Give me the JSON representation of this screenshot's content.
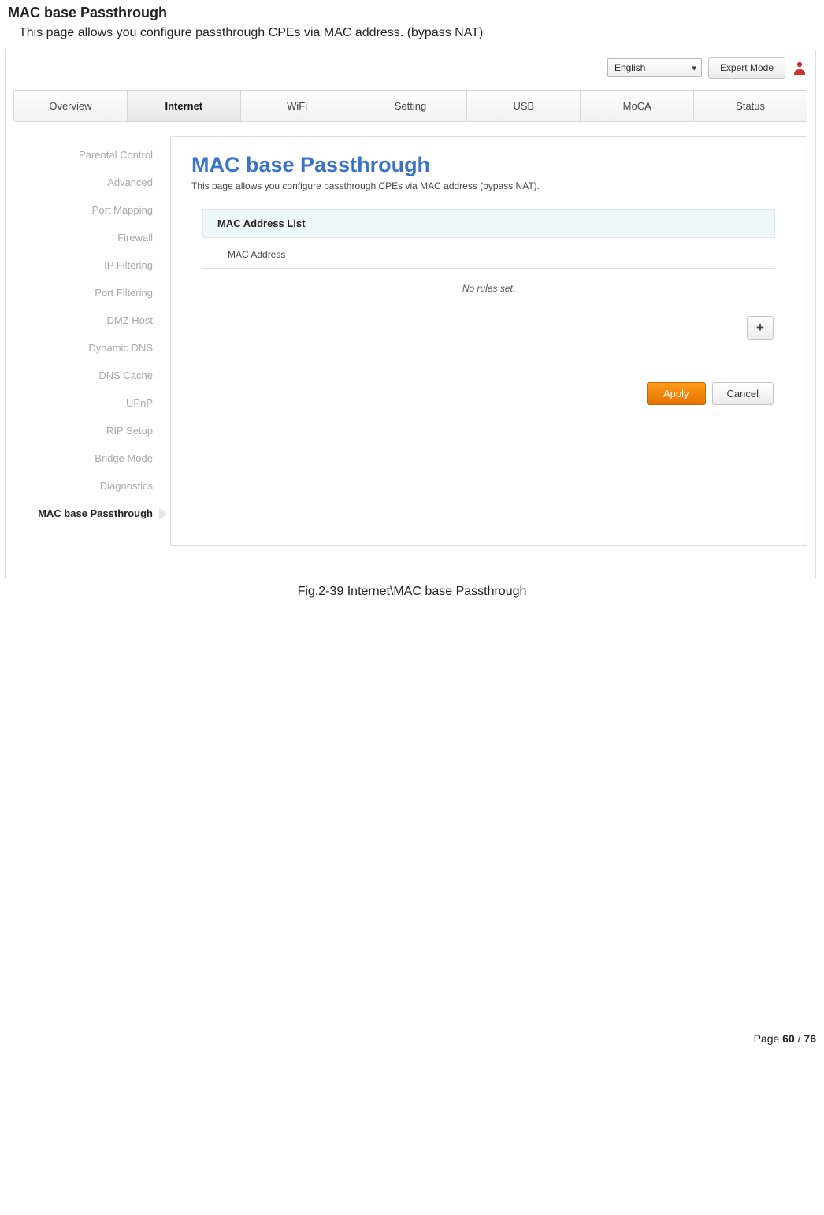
{
  "doc": {
    "title": "MAC base Passthrough",
    "desc": "This page allows you configure passthrough CPEs via MAC address. (bypass NAT)",
    "caption": "Fig.2-39 Internet\\MAC base Passthrough",
    "footer_label": "Page ",
    "footer_current": "60",
    "footer_sep": " / ",
    "footer_total": "76"
  },
  "topbar": {
    "language": "English",
    "expert_label": "Expert Mode"
  },
  "tabs": {
    "items": [
      {
        "label": "Overview"
      },
      {
        "label": "Internet"
      },
      {
        "label": "WiFi"
      },
      {
        "label": "Setting"
      },
      {
        "label": "USB"
      },
      {
        "label": "MoCA"
      },
      {
        "label": "Status"
      }
    ],
    "active_index": 1
  },
  "sidebar": {
    "items": [
      {
        "label": "Parental Control"
      },
      {
        "label": "Advanced"
      },
      {
        "label": "Port Mapping"
      },
      {
        "label": "Firewall"
      },
      {
        "label": "IP Filtering"
      },
      {
        "label": "Port Filtering"
      },
      {
        "label": "DMZ Host"
      },
      {
        "label": "Dynamic DNS"
      },
      {
        "label": "DNS Cache"
      },
      {
        "label": "UPnP"
      },
      {
        "label": "RIP Setup"
      },
      {
        "label": "Bridge Mode"
      },
      {
        "label": "Diagnostics"
      },
      {
        "label": "MAC base Passthrough"
      }
    ],
    "active_index": 13
  },
  "panel": {
    "title": "MAC base Passthrough",
    "desc": "This page allows you configure passthrough CPEs via MAC address (bypass NAT).",
    "section_header": "MAC Address List",
    "column_header": "MAC Address",
    "empty_msg": "No rules set.",
    "plus_label": "+",
    "apply_label": "Apply",
    "cancel_label": "Cancel"
  }
}
